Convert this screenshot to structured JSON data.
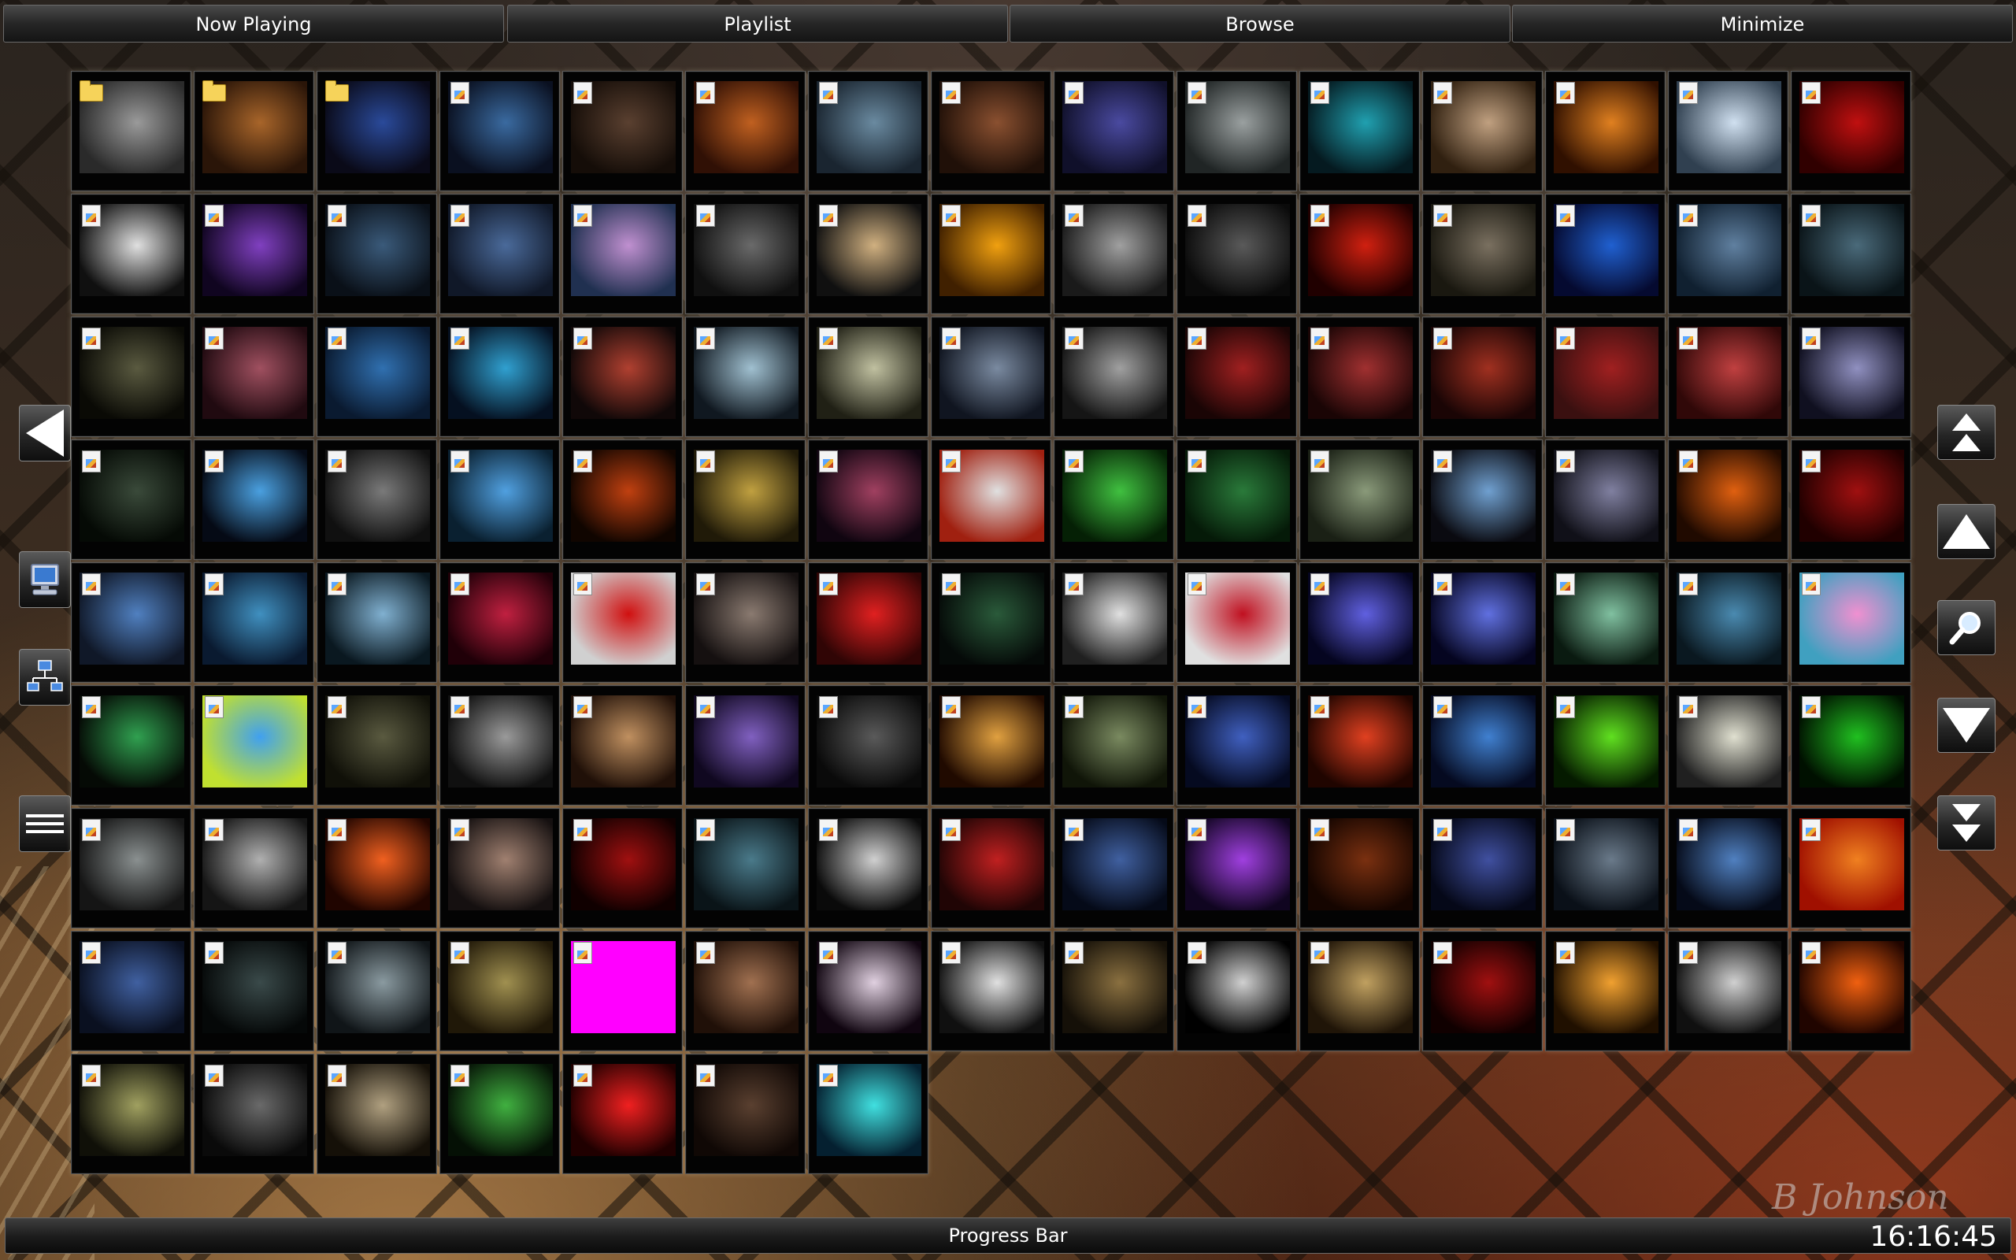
{
  "nav": [
    {
      "label": "Now Playing"
    },
    {
      "label": "Playlist"
    },
    {
      "label": "Browse"
    },
    {
      "label": "Minimize"
    }
  ],
  "left_controls": [
    {
      "name": "back-button",
      "icon": "left-arrow-icon"
    },
    {
      "name": "my-computer-button",
      "icon": "computer-icon"
    },
    {
      "name": "network-button",
      "icon": "network-icon"
    },
    {
      "name": "menu-button",
      "icon": "menu-icon"
    }
  ],
  "right_controls": [
    {
      "name": "page-up-button",
      "icon": "double-up-arrow-icon"
    },
    {
      "name": "scroll-up-button",
      "icon": "up-arrow-icon"
    },
    {
      "name": "search-button",
      "icon": "magnifier-icon"
    },
    {
      "name": "scroll-down-button",
      "icon": "down-arrow-icon"
    },
    {
      "name": "page-down-button",
      "icon": "double-down-arrow-icon"
    }
  ],
  "grid": {
    "tiles": [
      {
        "type": "folder",
        "colors": [
          "#9a9a9a",
          "#2a2a2a"
        ]
      },
      {
        "type": "folder",
        "colors": [
          "#a8652a",
          "#2a1508"
        ]
      },
      {
        "type": "folder",
        "colors": [
          "#2a4a9a",
          "#0a0a18"
        ]
      },
      {
        "type": "image",
        "colors": [
          "#3a6aa0",
          "#0a1020"
        ]
      },
      {
        "type": "image",
        "colors": [
          "#5a4030",
          "#150d08"
        ]
      },
      {
        "type": "image",
        "colors": [
          "#c06020",
          "#301005"
        ]
      },
      {
        "type": "image",
        "colors": [
          "#6a8aa0",
          "#1a2530"
        ]
      },
      {
        "type": "image",
        "colors": [
          "#8a5030",
          "#201008"
        ]
      },
      {
        "type": "image",
        "colors": [
          "#4a4aa0",
          "#10102a"
        ]
      },
      {
        "type": "image",
        "colors": [
          "#9aa0a0",
          "#202525"
        ]
      },
      {
        "type": "image",
        "colors": [
          "#20a0b0",
          "#051a20"
        ]
      },
      {
        "type": "image",
        "colors": [
          "#c0a080",
          "#302010"
        ]
      },
      {
        "type": "image",
        "colors": [
          "#e08020",
          "#301000"
        ]
      },
      {
        "type": "image",
        "colors": [
          "#d0e0f0",
          "#304050"
        ]
      },
      {
        "type": "image",
        "colors": [
          "#c01010",
          "#300000"
        ]
      },
      {
        "type": "image",
        "colors": [
          "#e0e0e0",
          "#101010"
        ]
      },
      {
        "type": "image",
        "colors": [
          "#8040c0",
          "#100520"
        ]
      },
      {
        "type": "image",
        "colors": [
          "#3a5a7a",
          "#0a1018"
        ]
      },
      {
        "type": "image",
        "colors": [
          "#4a6a9a",
          "#101828"
        ]
      },
      {
        "type": "image",
        "colors": [
          "#c090d0",
          "#203050"
        ]
      },
      {
        "type": "image",
        "colors": [
          "#6a6a6a",
          "#101010"
        ]
      },
      {
        "type": "image",
        "colors": [
          "#d0b080",
          "#101010"
        ]
      },
      {
        "type": "image",
        "colors": [
          "#f0a010",
          "#402000"
        ]
      },
      {
        "type": "image",
        "colors": [
          "#a0a0a0",
          "#1a1a1a"
        ]
      },
      {
        "type": "image",
        "colors": [
          "#5a5a5a",
          "#0a0a0a"
        ]
      },
      {
        "type": "image",
        "colors": [
          "#d02010",
          "#200000"
        ]
      },
      {
        "type": "image",
        "colors": [
          "#7a7060",
          "#1a1810"
        ]
      },
      {
        "type": "image",
        "colors": [
          "#2060d0",
          "#050a30"
        ]
      },
      {
        "type": "image",
        "colors": [
          "#6080a0",
          "#102030"
        ]
      },
      {
        "type": "image",
        "colors": [
          "#4a6a7a",
          "#0a1418"
        ]
      },
      {
        "type": "image",
        "colors": [
          "#5a5a40",
          "#0a0a05"
        ]
      },
      {
        "type": "image",
        "colors": [
          "#a05060",
          "#200a10"
        ]
      },
      {
        "type": "image",
        "colors": [
          "#3070b0",
          "#0a1a30"
        ]
      },
      {
        "type": "image",
        "colors": [
          "#30a0d0",
          "#051020"
        ]
      },
      {
        "type": "image",
        "colors": [
          "#b04030",
          "#100808"
        ]
      },
      {
        "type": "image",
        "colors": [
          "#a0c0d0",
          "#101820"
        ]
      },
      {
        "type": "image",
        "colors": [
          "#c0c0a0",
          "#202015"
        ]
      },
      {
        "type": "image",
        "colors": [
          "#7a8aa0",
          "#101520"
        ]
      },
      {
        "type": "image",
        "colors": [
          "#a0a0a0",
          "#151515"
        ]
      },
      {
        "type": "image",
        "colors": [
          "#a02020",
          "#1a0505"
        ]
      },
      {
        "type": "image",
        "colors": [
          "#a03030",
          "#1a0505"
        ]
      },
      {
        "type": "image",
        "colors": [
          "#a03020",
          "#1a0505"
        ]
      },
      {
        "type": "image",
        "colors": [
          "#a02020",
          "#3a1010"
        ]
      },
      {
        "type": "image",
        "colors": [
          "#c04040",
          "#300808"
        ]
      },
      {
        "type": "image",
        "colors": [
          "#9090c0",
          "#101020"
        ]
      },
      {
        "type": "image",
        "colors": [
          "#3a4a3a",
          "#050a05"
        ]
      },
      {
        "type": "image",
        "colors": [
          "#4aa0e0",
          "#050a15"
        ]
      },
      {
        "type": "image",
        "colors": [
          "#7a7a7a",
          "#101010"
        ]
      },
      {
        "type": "image",
        "colors": [
          "#50a0e0",
          "#0a2030"
        ]
      },
      {
        "type": "image",
        "colors": [
          "#c04010",
          "#100500"
        ]
      },
      {
        "type": "image",
        "colors": [
          "#c0a040",
          "#201a08"
        ]
      },
      {
        "type": "image",
        "colors": [
          "#a04060",
          "#100510"
        ]
      },
      {
        "type": "image",
        "colors": [
          "#e0e0e0",
          "#a02010"
        ]
      },
      {
        "type": "image",
        "colors": [
          "#40c040",
          "#052005"
        ]
      },
      {
        "type": "image",
        "colors": [
          "#2a7a3a",
          "#051a08"
        ]
      },
      {
        "type": "image",
        "colors": [
          "#8a9a7a",
          "#1a2015"
        ]
      },
      {
        "type": "image",
        "colors": [
          "#70a0d0",
          "#0a0a10"
        ]
      },
      {
        "type": "image",
        "colors": [
          "#8080a0",
          "#101018"
        ]
      },
      {
        "type": "image",
        "colors": [
          "#e06010",
          "#200a00"
        ]
      },
      {
        "type": "image",
        "colors": [
          "#a01010",
          "#200000"
        ]
      },
      {
        "type": "image",
        "colors": [
          "#5080c0",
          "#101828"
        ]
      },
      {
        "type": "image",
        "colors": [
          "#4090c0",
          "#0a1a30"
        ]
      },
      {
        "type": "image",
        "colors": [
          "#80b0d0",
          "#0a1820"
        ]
      },
      {
        "type": "image",
        "colors": [
          "#c02040",
          "#200008"
        ]
      },
      {
        "type": "image",
        "colors": [
          "#d01010",
          "#d0d0d0"
        ]
      },
      {
        "type": "image",
        "colors": [
          "#8a7a70",
          "#151010"
        ]
      },
      {
        "type": "image",
        "colors": [
          "#e02020",
          "#300505"
        ]
      },
      {
        "type": "image",
        "colors": [
          "#2a5a3a",
          "#050a08"
        ]
      },
      {
        "type": "image",
        "colors": [
          "#e0e0e0",
          "#202020"
        ]
      },
      {
        "type": "image",
        "colors": [
          "#c01020",
          "#e0e0e0"
        ]
      },
      {
        "type": "image",
        "colors": [
          "#6060e0",
          "#050520"
        ]
      },
      {
        "type": "image",
        "colors": [
          "#6070e0",
          "#050520"
        ]
      },
      {
        "type": "image",
        "colors": [
          "#80c0a0",
          "#0a1a10"
        ]
      },
      {
        "type": "image",
        "colors": [
          "#4a8ab0",
          "#0a1820"
        ]
      },
      {
        "type": "image",
        "colors": [
          "#f090d0",
          "#40a0c0"
        ]
      },
      {
        "type": "image",
        "colors": [
          "#30a050",
          "#050a05"
        ]
      },
      {
        "type": "image",
        "colors": [
          "#40a0f0",
          "#c0e030"
        ]
      },
      {
        "type": "image",
        "colors": [
          "#5a5a40",
          "#101008"
        ]
      },
      {
        "type": "image",
        "colors": [
          "#9a9a9a",
          "#101010"
        ]
      },
      {
        "type": "image",
        "colors": [
          "#c09060",
          "#201008"
        ]
      },
      {
        "type": "image",
        "colors": [
          "#8060c0",
          "#100820"
        ]
      },
      {
        "type": "image",
        "colors": [
          "#5a5a5a",
          "#0a0a0a"
        ]
      },
      {
        "type": "image",
        "colors": [
          "#e0a040",
          "#200a00"
        ]
      },
      {
        "type": "image",
        "colors": [
          "#7a8a60",
          "#101508"
        ]
      },
      {
        "type": "image",
        "colors": [
          "#4060c0",
          "#050a20"
        ]
      },
      {
        "type": "image",
        "colors": [
          "#e04020",
          "#200500"
        ]
      },
      {
        "type": "image",
        "colors": [
          "#4080d0",
          "#050a20"
        ]
      },
      {
        "type": "image",
        "colors": [
          "#60e020",
          "#051a00"
        ]
      },
      {
        "type": "image",
        "colors": [
          "#e0e0d0",
          "#202020"
        ]
      },
      {
        "type": "image",
        "colors": [
          "#20c020",
          "#001000"
        ]
      },
      {
        "type": "image",
        "colors": [
          "#8a9090",
          "#151515"
        ]
      },
      {
        "type": "image",
        "colors": [
          "#b0b0b0",
          "#151515"
        ]
      },
      {
        "type": "image",
        "colors": [
          "#f06020",
          "#200500"
        ]
      },
      {
        "type": "image",
        "colors": [
          "#a08070",
          "#151010"
        ]
      },
      {
        "type": "image",
        "colors": [
          "#a01010",
          "#100000"
        ]
      },
      {
        "type": "image",
        "colors": [
          "#4a7a8a",
          "#0a1418"
        ]
      },
      {
        "type": "image",
        "colors": [
          "#d0d0d0",
          "#0a0a0a"
        ]
      },
      {
        "type": "image",
        "colors": [
          "#c02020",
          "#200505"
        ]
      },
      {
        "type": "image",
        "colors": [
          "#4060a0",
          "#050a18"
        ]
      },
      {
        "type": "image",
        "colors": [
          "#a040e0",
          "#100520"
        ]
      },
      {
        "type": "image",
        "colors": [
          "#7a3010",
          "#150500"
        ]
      },
      {
        "type": "image",
        "colors": [
          "#4050a0",
          "#050818"
        ]
      },
      {
        "type": "image",
        "colors": [
          "#6a7a8a",
          "#0a1018"
        ]
      },
      {
        "type": "image",
        "colors": [
          "#5080c0",
          "#050a18"
        ]
      },
      {
        "type": "image",
        "colors": [
          "#f08020",
          "#a01000"
        ]
      },
      {
        "type": "image",
        "colors": [
          "#4060a0",
          "#0a1020"
        ]
      },
      {
        "type": "image",
        "colors": [
          "#3a4a4a",
          "#050808"
        ]
      },
      {
        "type": "image",
        "colors": [
          "#8a9aa0",
          "#101518"
        ]
      },
      {
        "type": "image",
        "colors": [
          "#a09050",
          "#201808"
        ]
      },
      {
        "type": "image",
        "colors": [
          "#ff00ff",
          "#ff00ff"
        ]
      },
      {
        "type": "image",
        "colors": [
          "#a07050",
          "#201008"
        ]
      },
      {
        "type": "image",
        "colors": [
          "#e0d0e0",
          "#100510"
        ]
      },
      {
        "type": "image",
        "colors": [
          "#e0e0e0",
          "#101010"
        ]
      },
      {
        "type": "image",
        "colors": [
          "#8a7040",
          "#151008"
        ]
      },
      {
        "type": "image",
        "colors": [
          "#d0d0d0",
          "#000000"
        ]
      },
      {
        "type": "image",
        "colors": [
          "#c0a060",
          "#201508"
        ]
      },
      {
        "type": "image",
        "colors": [
          "#a01010",
          "#100000"
        ]
      },
      {
        "type": "image",
        "colors": [
          "#f0a030",
          "#201000"
        ]
      },
      {
        "type": "image",
        "colors": [
          "#d0d0d0",
          "#101010"
        ]
      },
      {
        "type": "image",
        "colors": [
          "#f06010",
          "#200500"
        ]
      },
      {
        "type": "image",
        "colors": [
          "#a0a060",
          "#101008"
        ]
      },
      {
        "type": "image",
        "colors": [
          "#6a6a6a",
          "#0a0a0a"
        ]
      },
      {
        "type": "image",
        "colors": [
          "#b0a080",
          "#151008"
        ]
      },
      {
        "type": "image",
        "colors": [
          "#40b040",
          "#051005"
        ]
      },
      {
        "type": "image",
        "colors": [
          "#f02020",
          "#200000"
        ]
      },
      {
        "type": "image",
        "colors": [
          "#5a4030",
          "#100805"
        ]
      },
      {
        "type": "image",
        "colors": [
          "#40e0e0",
          "#052030"
        ]
      }
    ]
  },
  "progress": {
    "label": "Progress Bar"
  },
  "signature": "B Johnson",
  "clock": "16:16:45"
}
